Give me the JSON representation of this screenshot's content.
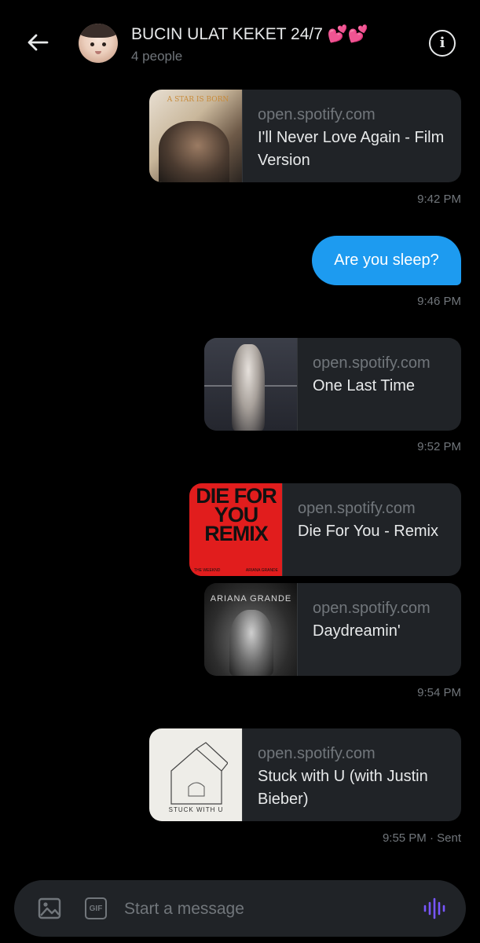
{
  "header": {
    "title": "BUCIN ULAT KEKET 24/7 💕💕",
    "subtitle": "4 people"
  },
  "messages": [
    {
      "domain": "open.spotify.com",
      "song": "I'll Never Love Again - Film Version",
      "art": "A STAR IS BORN"
    },
    {
      "time": "9:42 PM"
    },
    {
      "text": "Are you sleep?"
    },
    {
      "time": "9:46 PM"
    },
    {
      "domain": "open.spotify.com",
      "song": "One Last Time"
    },
    {
      "time": "9:52 PM"
    },
    {
      "domain": "open.spotify.com",
      "song": "Die For You - Remix",
      "art_lines": [
        "DIE FOR",
        "YOU",
        "REMIX"
      ],
      "art_credits": [
        "THE WEEKND",
        "ARIANA GRANDE"
      ]
    },
    {
      "domain": "open.spotify.com",
      "song": "Daydreamin'",
      "art_name": "ARIANA GRANDE"
    },
    {
      "time": "9:54 PM"
    },
    {
      "domain": "open.spotify.com",
      "song": "Stuck with U (with Justin Bieber)",
      "art_label": "STUCK WITH U"
    },
    {
      "time": "9:55 PM · Sent"
    }
  ],
  "composer": {
    "placeholder": "Start a message",
    "gif_label": "GIF"
  },
  "colors": {
    "background": "#000000",
    "card": "#202327",
    "accent": "#1d9bf0",
    "muted": "#71767b",
    "voice": "#7856ff"
  },
  "icons": [
    "back-arrow-icon",
    "info-icon",
    "image-icon",
    "gif-icon",
    "voice-wave-icon"
  ]
}
